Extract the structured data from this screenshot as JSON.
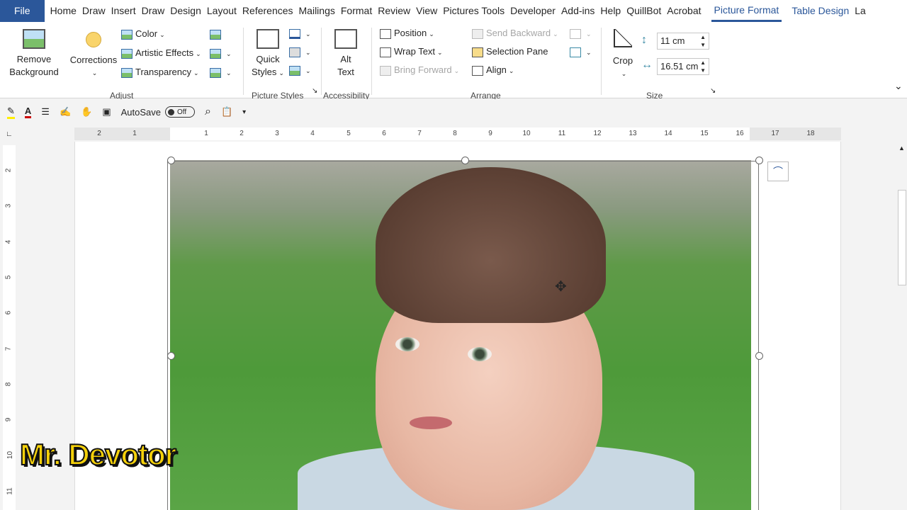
{
  "tabs": [
    "File",
    "Home",
    "Draw",
    "Insert",
    "Draw",
    "Design",
    "Layout",
    "References",
    "Mailings",
    "Format",
    "Review",
    "View",
    "Pictures Tools",
    "Developer",
    "Add-ins",
    "Help",
    "QuillBot",
    "Acrobat",
    "Picture Format",
    "Table Design",
    "La"
  ],
  "ribbon": {
    "remove_bg": [
      "Remove",
      "Background"
    ],
    "corrections": "Corrections",
    "color": "Color",
    "artistic": "Artistic Effects",
    "transparency": "Transparency",
    "adjust": "Adjust",
    "quick_styles": [
      "Quick",
      "Styles"
    ],
    "picture_styles": "Picture Styles",
    "alt_text": [
      "Alt",
      "Text"
    ],
    "accessibility": "Accessibility",
    "position": "Position",
    "wrap_text": "Wrap Text",
    "bring_forward": "Bring Forward",
    "send_backward": "Send Backward",
    "selection_pane": "Selection Pane",
    "align": "Align",
    "arrange": "Arrange",
    "crop": "Crop",
    "height": "11 cm",
    "width": "16.51 cm",
    "size": "Size"
  },
  "qat": {
    "autosave": "AutoSave",
    "toggle": "Off"
  },
  "ruler": {
    "h": [
      "2",
      "1",
      "1",
      "2",
      "3",
      "4",
      "5",
      "6",
      "7",
      "8",
      "9",
      "10",
      "11",
      "12",
      "13",
      "14",
      "15",
      "16",
      "17",
      "18"
    ],
    "v": [
      "2",
      "3",
      "4",
      "5",
      "6",
      "7",
      "8",
      "9",
      "10",
      "11"
    ]
  },
  "watermark": "Mr. Devotor",
  "colors": {
    "accent": "#2b579a",
    "watermark": "#f5d10a"
  }
}
